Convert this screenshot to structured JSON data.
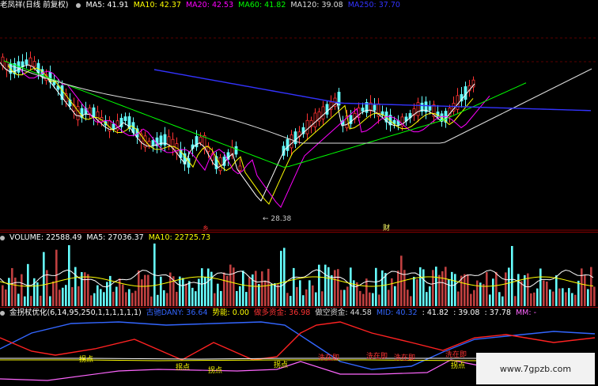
{
  "price_pane": {
    "stock_title": "老凤祥(日线 前复权)",
    "ma_items": [
      {
        "label": "MA5: 41.91",
        "color": "#ffffff"
      },
      {
        "label": "MA10: 42.37",
        "color": "#ffff00"
      },
      {
        "label": "MA20: 42.53",
        "color": "#ff00ff"
      },
      {
        "label": "MA60: 41.82",
        "color": "#00ff00"
      },
      {
        "label": "MA120: 39.08",
        "color": "#dddddd"
      },
      {
        "label": "MA250: 37.70",
        "color": "#3333ff"
      }
    ],
    "low_marker": "28.38",
    "event_marks": [
      "乡",
      "财"
    ]
  },
  "volume_pane": {
    "label": "VOLUME: 22588.49",
    "ma5": "MA5: 27036.37",
    "ma10": "MA10: 22725.73"
  },
  "indicator_pane": {
    "name": "金拐杖优化(6,14,95,250,1,1,1,1,1,1)",
    "items": [
      {
        "label": "古驰DANY: 36.64",
        "color": "#3366ff"
      },
      {
        "label": "势能: 0.00",
        "color": "#ffff00"
      },
      {
        "label": "做多资金: 36.98",
        "color": "#ff3333"
      },
      {
        "label": "做空资金: 44.58",
        "color": "#dddddd"
      },
      {
        "label": "MID: 40.32",
        "color": "#3366ff"
      },
      {
        "label": ": 41.82",
        "color": "#ffffff"
      },
      {
        "label": ": 39.08",
        "color": "#ffffff"
      },
      {
        "label": ": 37.78",
        "color": "#ffffff"
      },
      {
        "label": "MM: -",
        "color": "#ff66ff"
      }
    ],
    "labels": [
      "拐点",
      "拐点",
      "拐点",
      "拐点",
      "拐点",
      "洗在即",
      "洗在即",
      "洗在即",
      "洗在即"
    ]
  },
  "watermark": "www.7gpzb.com"
}
